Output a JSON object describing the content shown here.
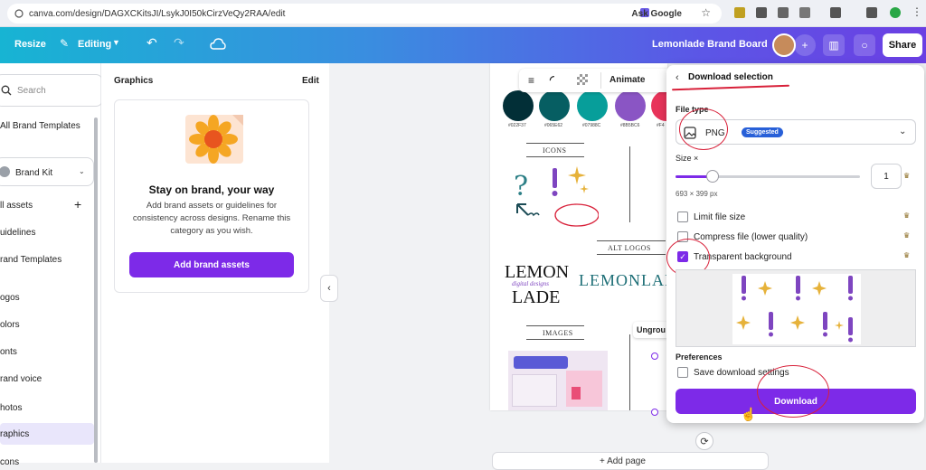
{
  "browser": {
    "url": "canva.com/design/DAGXCKitsJI/LsykJ0I50kCirzVeQy2RAA/edit",
    "ask_google": "Ask Google"
  },
  "header": {
    "resize": "Resize",
    "editing": "Editing",
    "design_title": "Lemonlade Brand Board",
    "share": "Share"
  },
  "leftnav": {
    "search_placeholder": "Search",
    "all_brand_templates": "All Brand Templates",
    "brand_kit": "Brand Kit",
    "items": [
      "ll assets",
      "uidelines",
      "rand Templates",
      "ogos",
      "olors",
      "onts",
      "rand voice",
      "hotos",
      "raphics",
      "cons"
    ]
  },
  "panel": {
    "title": "Graphics",
    "edit": "Edit",
    "card_title": "Stay on brand, your way",
    "card_body": "Add brand assets or guidelines for consistency across designs. Rename this category as you wish.",
    "add_button": "Add brand assets"
  },
  "canvas": {
    "animate": "Animate",
    "swatches": [
      {
        "color": "#022f37",
        "hex": "#022F37"
      },
      {
        "color": "#065e62",
        "hex": "#065E62"
      },
      {
        "color": "#079e9a",
        "hex": "#07988C"
      },
      {
        "color": "#8a55c4",
        "hex": "#8B5BC6"
      },
      {
        "color": "#e8345a",
        "hex": "#F4"
      }
    ],
    "icons_label": "ICONS",
    "alt_logos_label": "ALT LOGOS",
    "images_label": "IMAGES",
    "logo_lemon": "LEMON",
    "logo_lade": "LADE",
    "logo_script": "digital designs",
    "logo_wide": "LEMONLAI",
    "ungroup": "Ungrou",
    "add_page": "+ Add page"
  },
  "download": {
    "title": "Download selection",
    "file_type_label": "File type",
    "file_type_value": "PNG",
    "suggested": "Suggested",
    "size_label": "Size ×",
    "size_value": "1",
    "dimensions": "693 × 399 px",
    "limit_file_size": "Limit file size",
    "compress_file": "Compress file (lower quality)",
    "transparent_bg": "Transparent background",
    "preferences": "Preferences",
    "save_settings": "Save download settings",
    "download_button": "Download",
    "size_fraction": 0.2,
    "transparent_checked": true
  },
  "colors": {
    "brand_purple": "#7d2ae8",
    "annotation_red": "#d8213a"
  }
}
